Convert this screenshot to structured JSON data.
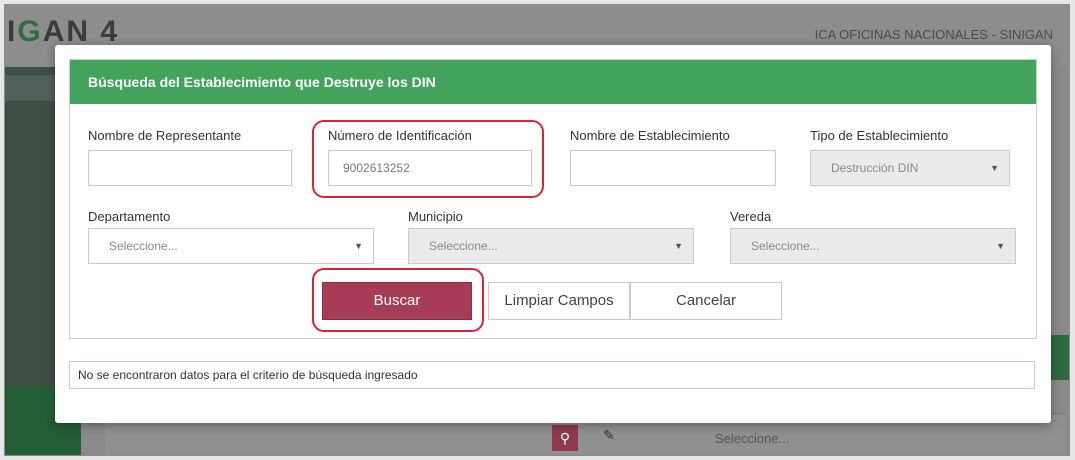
{
  "background": {
    "logo_prefix": "I",
    "logo_green": "G",
    "logo_rest": "AN 4",
    "org_label": "ICA OFICINAS NACIONALES - SINIGAN",
    "search_icon": "search-icon",
    "eraser_icon": "eraser-icon",
    "select_placeholder": "Seleccione..."
  },
  "modal": {
    "title": "Búsqueda del Establecimiento que Destruye los DIN",
    "fields": {
      "representante": {
        "label": "Nombre de Representante",
        "value": ""
      },
      "identificacion": {
        "label": "Número de Identificación",
        "value": "9002613252"
      },
      "establecimiento": {
        "label": "Nombre de Establecimiento",
        "value": ""
      },
      "tipo": {
        "label": "Tipo de Establecimiento",
        "value": "Destrucción DIN"
      },
      "departamento": {
        "label": "Departamento",
        "value": "Seleccione..."
      },
      "municipio": {
        "label": "Municipio",
        "value": "Seleccione..."
      },
      "vereda": {
        "label": "Vereda",
        "value": "Seleccione..."
      }
    },
    "buttons": {
      "buscar": "Buscar",
      "limpiar": "Limpiar Campos",
      "cancelar": "Cancelar"
    },
    "message": "No se encontraron datos para el criterio de búsqueda ingresado"
  },
  "colors": {
    "header_green": "#43a35a",
    "buscar_button": "#a63c55",
    "highlight_red": "#d8243a"
  }
}
